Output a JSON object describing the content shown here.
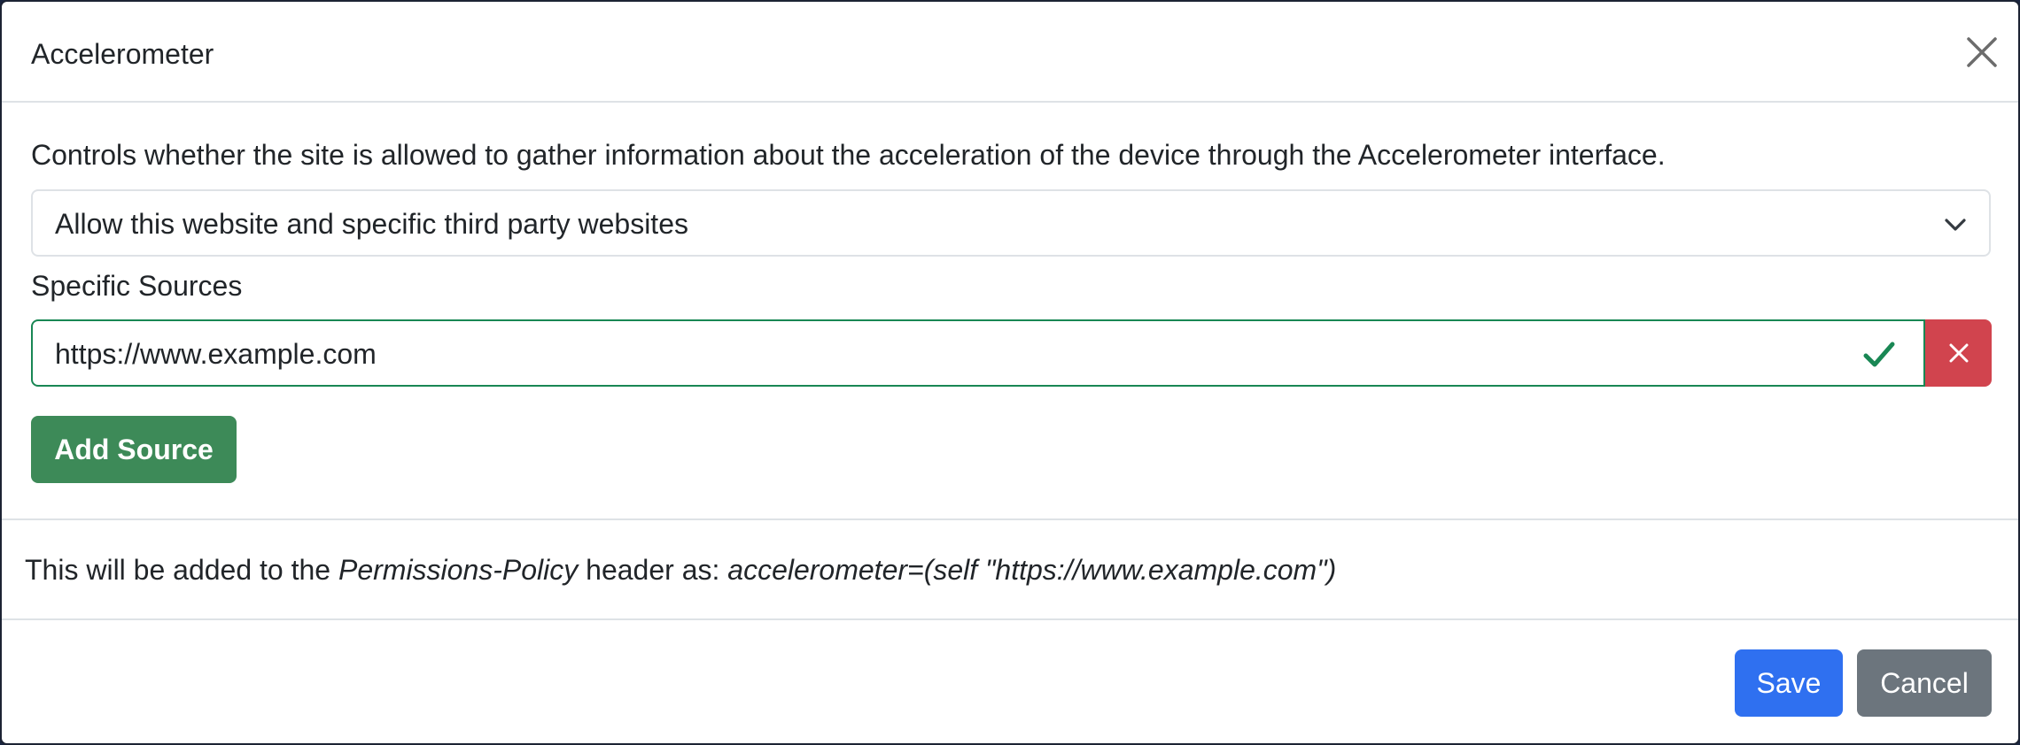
{
  "modal": {
    "title": "Accelerometer",
    "description": "Controls whether the site is allowed to gather information about the acceleration of the device through the Accelerometer interface.",
    "policy_select": {
      "selected": "Allow this website and specific third party websites"
    },
    "sources": {
      "label": "Specific Sources",
      "items": [
        {
          "value": "https://www.example.com",
          "valid": true
        }
      ],
      "add_label": "Add Source"
    },
    "header_preview": {
      "prefix": "This will be added to the ",
      "header_name": "Permissions-Policy",
      "middle": " header as: ",
      "value": "accelerometer=(self \"https://www.example.com\")"
    },
    "footer": {
      "save_label": "Save",
      "cancel_label": "Cancel"
    }
  },
  "icons": {
    "close": "close-icon",
    "chevron": "chevron-down-icon",
    "valid": "check-icon",
    "remove": "x-icon"
  },
  "colors": {
    "valid_border": "#198754",
    "remove_button": "#d1444e",
    "add_button": "#3d8a58",
    "primary": "#2f70f0",
    "secondary": "#6c757d"
  }
}
